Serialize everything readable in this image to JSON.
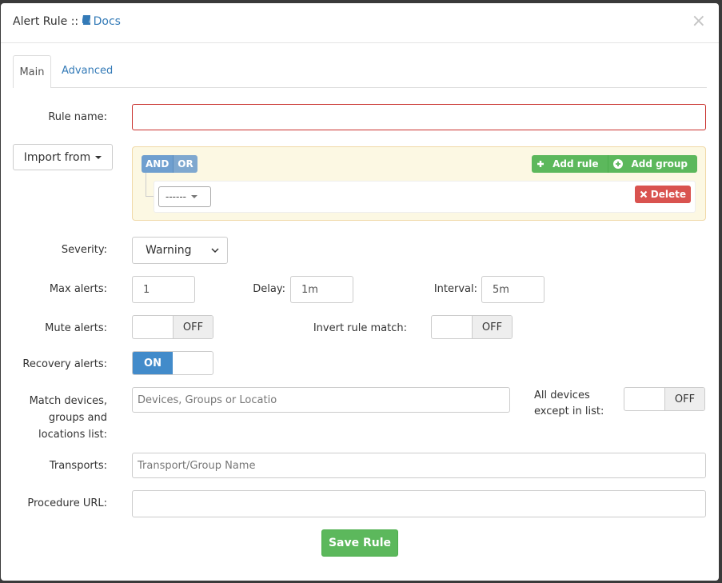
{
  "header": {
    "title_prefix": "Alert Rule ::",
    "docs_link": "Docs",
    "close_symbol": "×"
  },
  "tabs": [
    {
      "label": "Main",
      "active": true
    },
    {
      "label": "Advanced",
      "active": false
    }
  ],
  "rule_name": {
    "label": "Rule name:",
    "value": ""
  },
  "import_from": {
    "label": "Import from"
  },
  "query_builder": {
    "and_label": "AND",
    "or_label": "OR",
    "add_rule_label": "Add rule",
    "add_group_label": "Add group",
    "rule_select_value": "------",
    "delete_label": "Delete"
  },
  "severity": {
    "label": "Severity:",
    "value": "Warning"
  },
  "max_alerts": {
    "label": "Max alerts:",
    "value": "1"
  },
  "delay": {
    "label": "Delay:",
    "value": "1m"
  },
  "interval": {
    "label": "Interval:",
    "value": "5m"
  },
  "mute_alerts": {
    "label": "Mute alerts:",
    "state": "OFF"
  },
  "invert_rule_match": {
    "label": "Invert rule match:",
    "state": "OFF"
  },
  "recovery_alerts": {
    "label": "Recovery alerts:",
    "state": "ON"
  },
  "match_devices": {
    "label_line1": "Match devices,",
    "label_line2": "groups and",
    "label_line3": "locations list:",
    "placeholder": "Devices, Groups or Locatio"
  },
  "all_devices_except": {
    "label_line1": "All devices",
    "label_line2": "except in list:",
    "state": "OFF"
  },
  "transports": {
    "label": "Transports:",
    "placeholder": "Transport/Group Name"
  },
  "procedure_url": {
    "label": "Procedure URL:",
    "value": ""
  },
  "save_button": {
    "label": "Save Rule"
  },
  "colors": {
    "primary": "#337ab7",
    "success": "#5cb85c",
    "danger": "#d9534f",
    "toggle_on": "#428bca",
    "query_builder_bg": "#fcf8e3"
  },
  "icons": [
    "book-icon",
    "close-icon",
    "plus-icon",
    "plus-circle-icon",
    "x-icon",
    "caret-down-icon"
  ]
}
